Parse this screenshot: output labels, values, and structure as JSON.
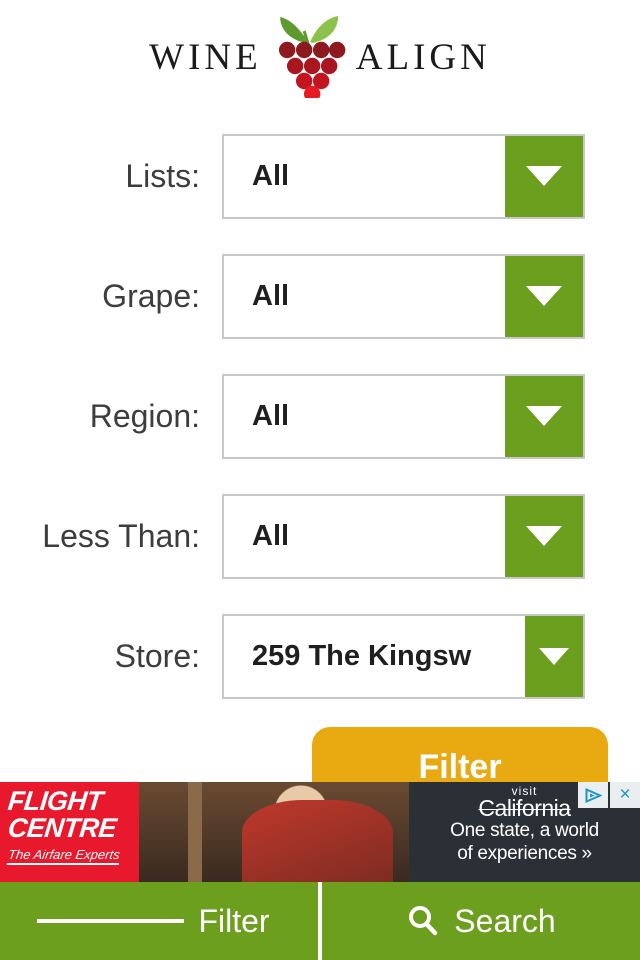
{
  "logo": {
    "word_left": "WINE",
    "word_right": "ALIGN",
    "icon": "grape-cluster-icon",
    "berry_dark_color": "#8C1A20",
    "berry_bright_color": "#E81B23",
    "leaf_color": "#7CB342"
  },
  "filters": [
    {
      "label": "Lists:",
      "value": "All",
      "name": "lists"
    },
    {
      "label": "Grape:",
      "value": "All",
      "name": "grape"
    },
    {
      "label": "Region:",
      "value": "All",
      "name": "region"
    },
    {
      "label": "Less Than:",
      "value": "All",
      "name": "less-than"
    },
    {
      "label": "Store:",
      "value": "259 The Kingsw",
      "name": "store"
    }
  ],
  "submit": {
    "label": "Filter",
    "color": "#E8A911"
  },
  "ad": {
    "brand_line1": "FLIGHT",
    "brand_line2": "CENTRE",
    "tagline": "The Airfare Experts",
    "visit": "visit",
    "destination": "California",
    "headline_line1": "One state, a world",
    "headline_line2": "of experiences »",
    "adchoices_icon": "adchoices-triangle-icon",
    "close_icon": "×",
    "brand_bg": "#E8192C"
  },
  "bottom_nav": {
    "background": "#6D9F1F",
    "items": [
      {
        "label": "Filter",
        "icon": "list-lines-icon"
      },
      {
        "label": "Search",
        "icon": "magnifier-icon"
      }
    ]
  },
  "theme": {
    "green": "#6D9F1F",
    "border_gray": "#C8C8C8",
    "label_gray": "#3D3D3D"
  }
}
